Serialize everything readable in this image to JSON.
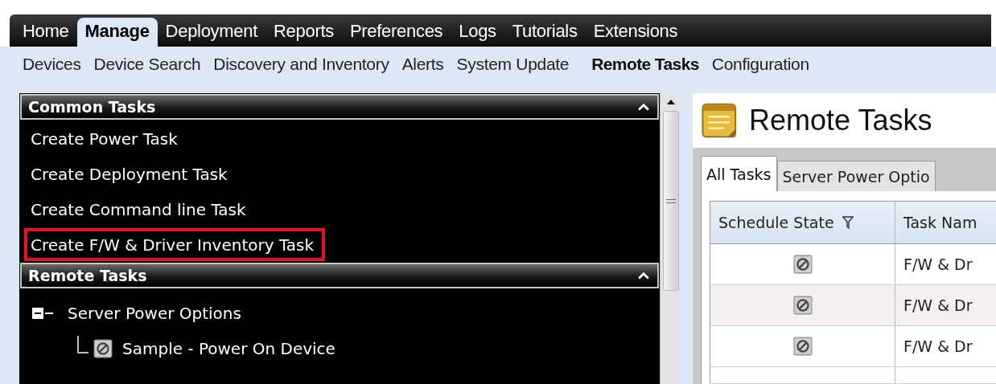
{
  "main_tabs": [
    {
      "label": "Home",
      "selected": false
    },
    {
      "label": "Manage",
      "selected": true
    },
    {
      "label": "Deployment",
      "selected": false
    },
    {
      "label": "Reports",
      "selected": false
    },
    {
      "label": "Preferences",
      "selected": false
    },
    {
      "label": "Logs",
      "selected": false
    },
    {
      "label": "Tutorials",
      "selected": false
    },
    {
      "label": "Extensions",
      "selected": false
    }
  ],
  "sub_tabs": [
    {
      "label": "Devices",
      "selected": false
    },
    {
      "label": "Device Search",
      "selected": false
    },
    {
      "label": "Discovery and Inventory",
      "selected": false
    },
    {
      "label": "Alerts",
      "selected": false
    },
    {
      "label": "System Update",
      "selected": false
    },
    {
      "label": "Remote Tasks",
      "selected": true
    },
    {
      "label": "Configuration",
      "selected": false
    }
  ],
  "common_tasks": {
    "title": "Common Tasks",
    "expanded": true,
    "items": [
      {
        "label": "Create Power Task",
        "highlighted": false
      },
      {
        "label": "Create Deployment Task",
        "highlighted": false
      },
      {
        "label": "Create Command line Task",
        "highlighted": false
      },
      {
        "label": "Create F/W & Driver Inventory Task",
        "highlighted": true
      }
    ]
  },
  "remote_tasks": {
    "title": "Remote Tasks",
    "expanded": true,
    "tree": [
      {
        "label": "Server Power Options",
        "expanded": true,
        "children": [
          {
            "label": "Sample - Power On Device"
          }
        ]
      }
    ]
  },
  "page": {
    "title": "Remote Tasks"
  },
  "tabs": [
    {
      "label": "All Tasks",
      "selected": true
    },
    {
      "label": "Server Power Optio",
      "selected": false
    }
  ],
  "table": {
    "columns": [
      "Schedule State",
      "Task Nam"
    ],
    "rows": [
      {
        "task_name": "F/W & Dr"
      },
      {
        "task_name": "F/W & Dr"
      },
      {
        "task_name": "F/W & Dr"
      }
    ]
  }
}
